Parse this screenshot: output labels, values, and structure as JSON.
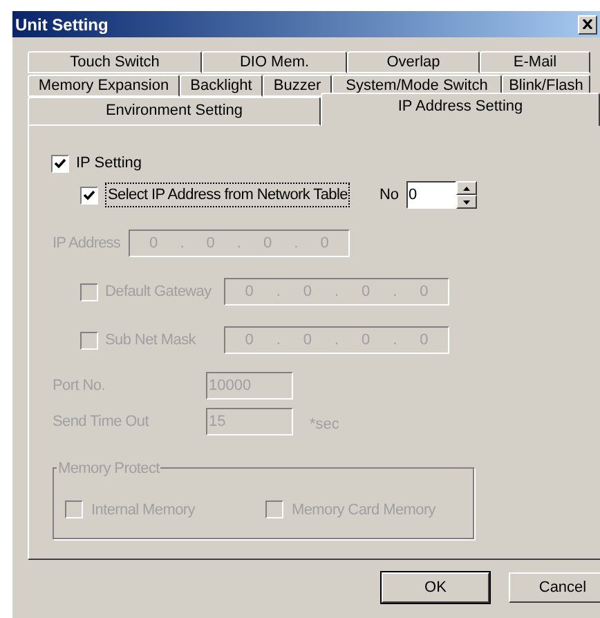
{
  "window": {
    "title": "Unit Setting"
  },
  "tab_rows": [
    [
      {
        "label": "Touch Switch",
        "selected": false
      },
      {
        "label": "DIO Mem.",
        "selected": false
      },
      {
        "label": "Overlap",
        "selected": false
      },
      {
        "label": "E-Mail",
        "selected": false
      }
    ],
    [
      {
        "label": "Memory Expansion",
        "selected": false
      },
      {
        "label": "Backlight",
        "selected": false
      },
      {
        "label": "Buzzer",
        "selected": false
      },
      {
        "label": "System/Mode Switch",
        "selected": false
      },
      {
        "label": "Blink/Flash",
        "selected": false
      }
    ],
    [
      {
        "label": "Environment Setting",
        "selected": false
      },
      {
        "label": "IP Address Setting",
        "selected": true
      }
    ]
  ],
  "ip_setting": {
    "label": "IP Setting",
    "checked": true,
    "disabled": false
  },
  "select_from_table": {
    "label": "Select IP Address from Network Table",
    "checked": true,
    "disabled": false,
    "no_label": "No",
    "no_value": "0"
  },
  "ip_address": {
    "label": "IP Address",
    "disabled": true,
    "separator": ".",
    "octets": [
      "0",
      "0",
      "0",
      "0"
    ]
  },
  "default_gateway": {
    "label": "Default Gateway",
    "checked": false,
    "disabled": true,
    "separator": ".",
    "octets": [
      "0",
      "0",
      "0",
      "0"
    ]
  },
  "sub_net_mask": {
    "label": "Sub Net Mask",
    "checked": false,
    "disabled": true,
    "separator": ".",
    "octets": [
      "0",
      "0",
      "0",
      "0"
    ]
  },
  "port_no": {
    "label": "Port No.",
    "value": "10000",
    "disabled": true
  },
  "send_time_out": {
    "label": "Send Time Out",
    "value": "15",
    "unit": "*sec",
    "disabled": true
  },
  "memory_protect": {
    "title": "Memory Protect",
    "disabled": true,
    "options": [
      {
        "label": "Internal Memory",
        "checked": false
      },
      {
        "label": "Memory Card Memory",
        "checked": false
      }
    ]
  },
  "buttons": [
    {
      "label": "OK",
      "default": true
    },
    {
      "label": "Cancel",
      "default": false
    }
  ]
}
